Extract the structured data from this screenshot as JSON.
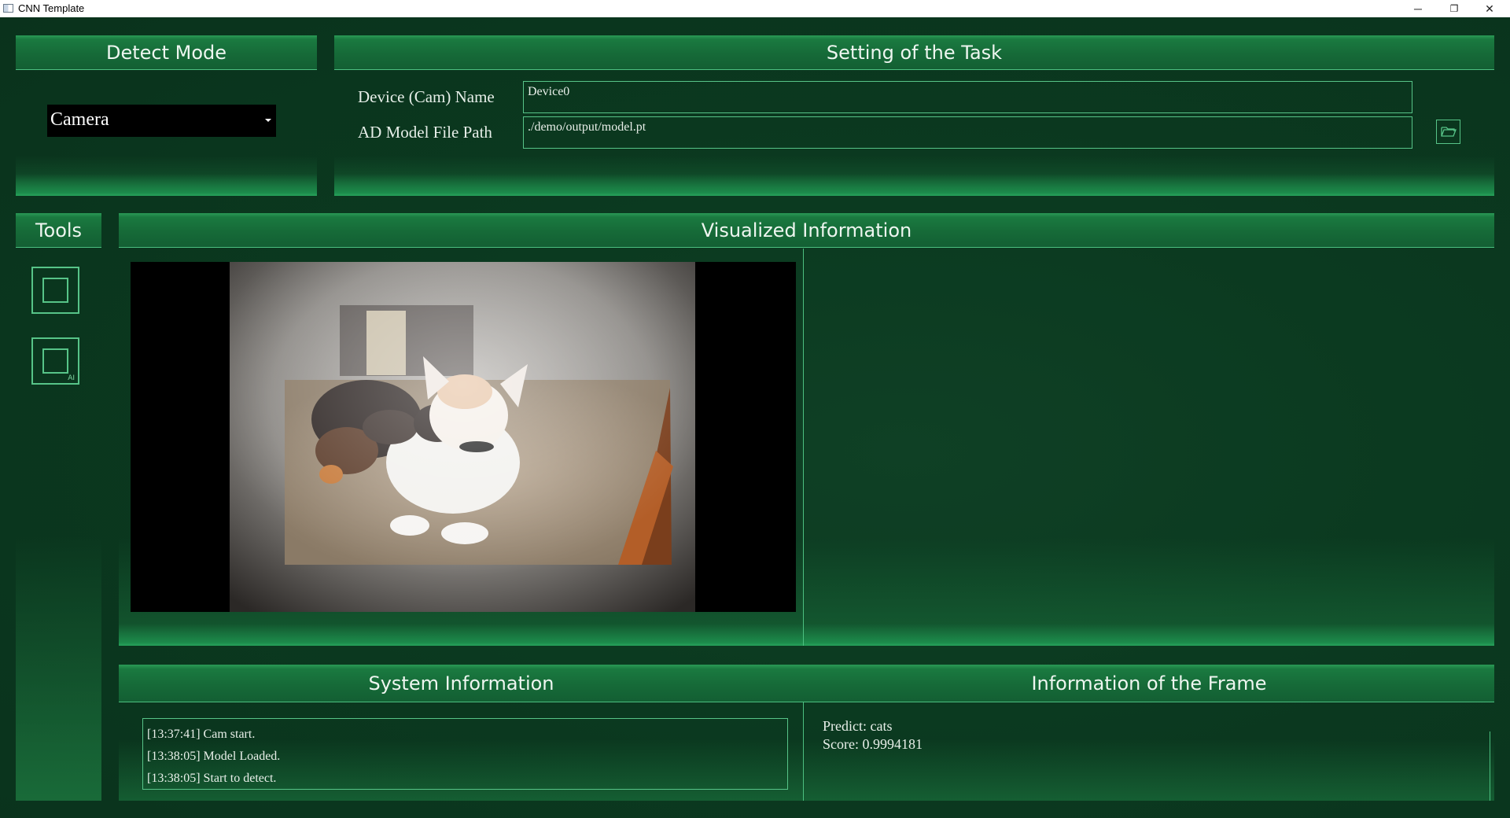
{
  "window": {
    "title": "CNN Template",
    "minimize": "─",
    "restore": "❐",
    "close": "✕"
  },
  "detect_mode": {
    "title": "Detect Mode",
    "selected": "Camera"
  },
  "task": {
    "title": "Setting of the Task",
    "device_label": "Device (Cam) Name",
    "device_value": "Device0",
    "model_label": "AD Model File Path",
    "model_value": "./demo/output/model.pt",
    "browse_icon": "folder-open-icon"
  },
  "tools": {
    "title": "Tools",
    "items": [
      "select-box-icon",
      "ai-box-icon"
    ],
    "ai_badge": "AI"
  },
  "visual": {
    "title": "Visualized Information"
  },
  "system": {
    "title": "System Information",
    "logs": [
      "[13:37:41] Cam start.",
      "[13:38:05] Model Loaded.",
      "[13:38:05] Start to detect."
    ]
  },
  "frame": {
    "title": "Information of the Frame",
    "predict": "Predict: cats",
    "score": "Score: 0.9994181"
  },
  "colors": {
    "accent": "#57c488",
    "header": "#1a7a40",
    "background": "#0b3a20"
  }
}
